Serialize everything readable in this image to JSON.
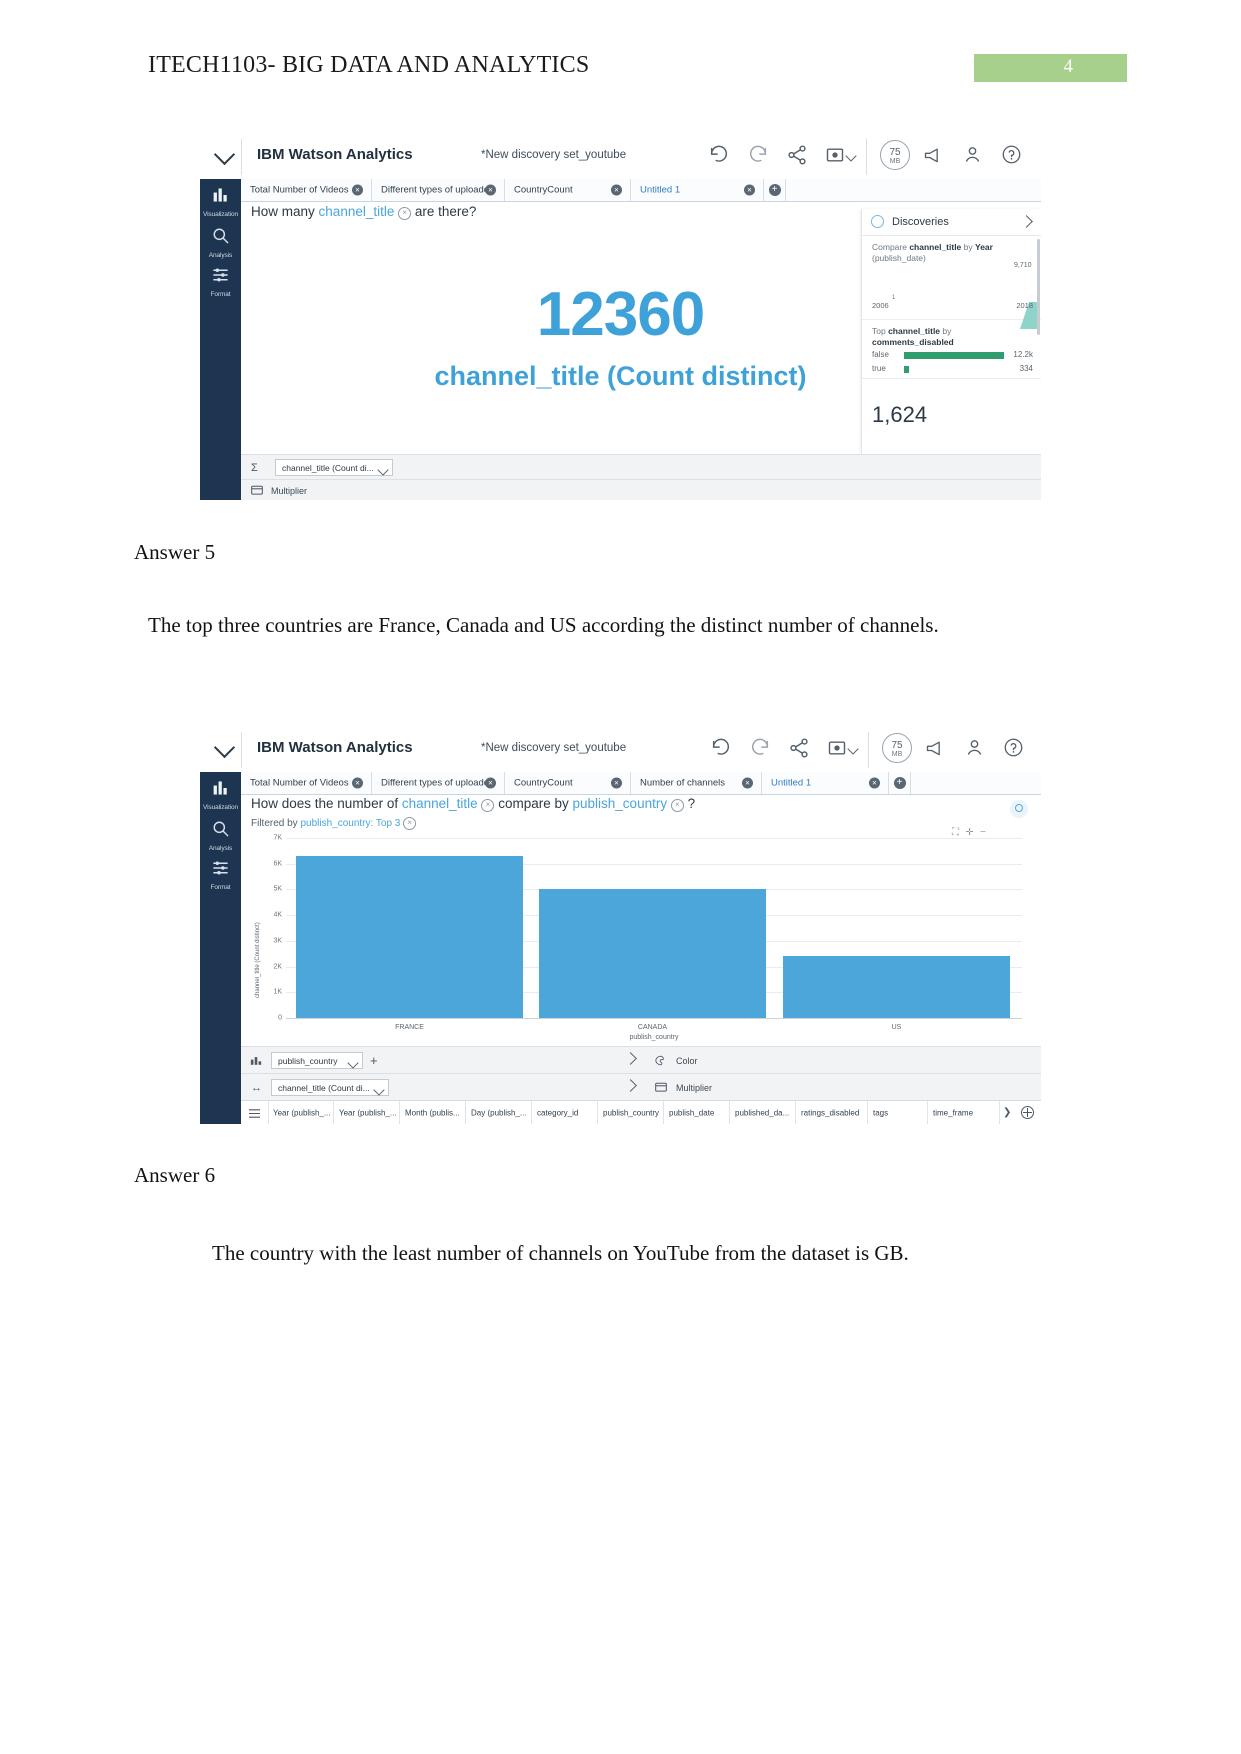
{
  "document": {
    "header_title": "ITECH1103- BIG DATA AND ANALYTICS",
    "page_number": "4",
    "header_badge_color": "#a8d08d"
  },
  "answers": [
    {
      "label": "Answer 5",
      "text": "The top three countries are France, Canada and US according the distinct number of channels."
    },
    {
      "label": "Answer 6",
      "text": "The country with the least number of channels on YouTube from the dataset is GB."
    }
  ],
  "screenshot1": {
    "brand": "IBM Watson Analytics",
    "doc_name": "*New discovery set_youtube",
    "toolbar": {
      "undo": "undo-arrow",
      "redo": "redo-arrow",
      "share": "share-icon",
      "export": "export-icon",
      "meter_value": "75",
      "meter_unit": "MB",
      "announce": "megaphone-icon",
      "user": "user-icon",
      "help": "help-icon"
    },
    "rail": [
      {
        "label": "Visualization",
        "icon": "bar-chart-icon"
      },
      {
        "label": "Analysis",
        "icon": "magnifier-icon"
      },
      {
        "label": "Format",
        "icon": "sliders-icon"
      }
    ],
    "tabs": [
      {
        "label": "Total Number of Videos",
        "active": false
      },
      {
        "label": "Different types of uploade...",
        "active": false
      },
      {
        "label": "CountryCount",
        "active": false
      },
      {
        "label": "Untitled 1",
        "active": true
      }
    ],
    "question": {
      "pre": "How many",
      "field": "channel_title",
      "post": "are there?"
    },
    "visual": {
      "value": "12360",
      "caption": "channel_title (Count distinct)"
    },
    "discoveries": {
      "title": "Discoveries",
      "cards": [
        {
          "text_plain_1": "Compare ",
          "text_bold_1": "channel_title",
          "text_plain_2": " by ",
          "text_bold_2": "Year",
          "text_plain_3": "(publish_date)",
          "axis_left": "2006",
          "axis_right": "2018",
          "peak_value": "9,710"
        },
        {
          "text_plain_1": "Top ",
          "text_bold_1": "channel_title",
          "text_plain_2": " by",
          "text_bold_2": "comments_disabled",
          "rows": [
            {
              "name": "false",
              "value": "12.2k",
              "pct": 100
            },
            {
              "name": "true",
              "value": "334",
              "pct": 4
            }
          ]
        },
        {
          "value": "1,624"
        }
      ]
    },
    "bottom": [
      {
        "icon": "sigma-icon",
        "pill": "channel_title (Count di...",
        "label": ""
      },
      {
        "icon": "multiplier-icon",
        "pill": "",
        "label": "Multiplier"
      }
    ]
  },
  "screenshot2": {
    "brand": "IBM Watson Analytics",
    "doc_name": "*New discovery set_youtube",
    "toolbar": {
      "meter_value": "75",
      "meter_unit": "MB"
    },
    "rail": [
      {
        "label": "Visualization",
        "icon": "bar-chart-icon"
      },
      {
        "label": "Analysis",
        "icon": "magnifier-icon"
      },
      {
        "label": "Format",
        "icon": "sliders-icon"
      }
    ],
    "tabs": [
      {
        "label": "Total Number of Videos",
        "active": false
      },
      {
        "label": "Different types of uploade...",
        "active": false
      },
      {
        "label": "CountryCount",
        "active": false
      },
      {
        "label": "Number of channels",
        "active": false
      },
      {
        "label": "Untitled 1",
        "active": true
      }
    ],
    "question": {
      "pre": "How does the number of",
      "field1": "channel_title",
      "mid": "compare by",
      "field2": "publish_country",
      "post": "?"
    },
    "filter": {
      "pre": "Filtered by",
      "field": "publish_country: Top 3"
    },
    "bottom": [
      {
        "icon": "chart-icon",
        "pill": "publish_country",
        "plus": "+"
      },
      {
        "icon": "arrows-icon",
        "pill": "channel_title (Count di...",
        "plus": ""
      }
    ],
    "right_bottom": [
      {
        "icon": "palette-icon",
        "label": "Color"
      },
      {
        "icon": "multiplier-icon",
        "label": "Multiplier"
      }
    ],
    "data_columns": [
      "Year (publish_...",
      "Year (publish_...",
      "Month (publis...",
      "Day (publish_...",
      "category_id",
      "publish_country",
      "publish_date",
      "published_da...",
      "ratings_disabled",
      "tags",
      "time_frame"
    ],
    "chart_data": {
      "type": "bar",
      "title": "",
      "categories": [
        "FRANCE",
        "CANADA",
        "US"
      ],
      "values": [
        6300,
        5000,
        2400
      ],
      "xlabel": "publish_country",
      "ylabel": "channel_title (Count distinct)",
      "ylim": [
        0,
        7000
      ],
      "yticks": [
        "0",
        "1K",
        "2K",
        "3K",
        "4K",
        "5K",
        "6K",
        "7K"
      ],
      "grid": true,
      "legend": "none",
      "bar_color": "#4da6d9"
    }
  }
}
